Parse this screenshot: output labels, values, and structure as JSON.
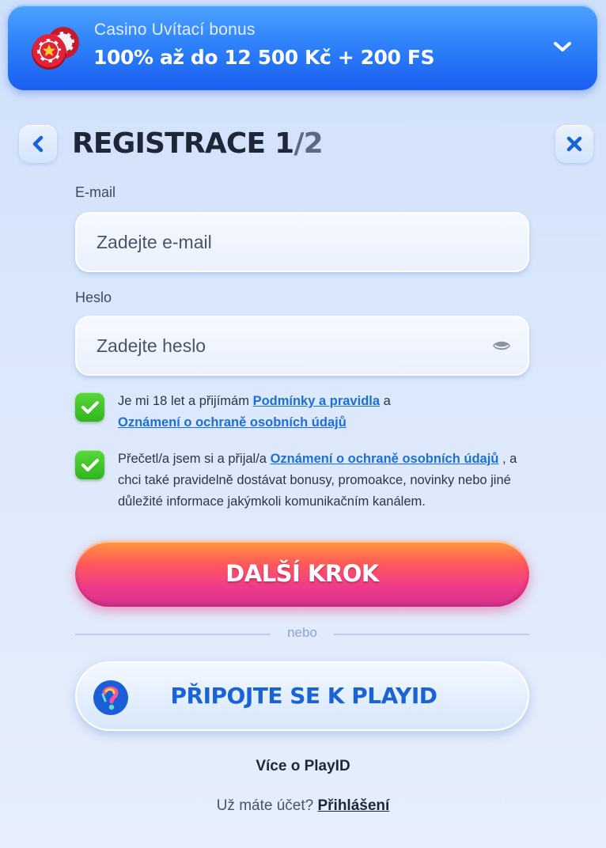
{
  "bonus": {
    "subtitle": "Casino Uvítací bonus",
    "headline": "100% až do 12 500 Kč + 200 FS"
  },
  "header": {
    "title": "REGISTRACE 1",
    "step_separator": "/2"
  },
  "form": {
    "email": {
      "label": "E-mail",
      "placeholder": "Zadejte e-mail",
      "value": ""
    },
    "password": {
      "label": "Heslo",
      "placeholder": "Zadejte heslo",
      "value": ""
    },
    "consent_terms": {
      "checked": true,
      "text_before": "Je mi 18 let a přijímám ",
      "link_terms": "Podmínky a pravidla",
      "text_middle": " a ",
      "link_privacy": "Oznámení o ochraně osobních údajů"
    },
    "consent_marketing": {
      "checked": true,
      "text_before": "Přečetl/a jsem si a přijal/a ",
      "link_privacy": "Oznámení o ochraně osobních údajů",
      "text_after": " , a chci také pravidelně dostávat bonusy, promoakce, novinky nebo jiné důležité informace jakýmkoli komunikačním kanálem."
    }
  },
  "actions": {
    "next_step": "DALŠÍ KROK",
    "divider": "nebo",
    "playid": "PŘIPOJTE SE K PLAYID",
    "more_playid": "Více o PlayID",
    "login_prompt": "Už máte účet? ",
    "login_link": "Přihlášení"
  },
  "colors": {
    "banner": "#2d7ff9",
    "link": "#1c6fd8",
    "check": "#3cc42a",
    "primary_button": "#f03b8a",
    "playid_text": "#1a63d6"
  }
}
